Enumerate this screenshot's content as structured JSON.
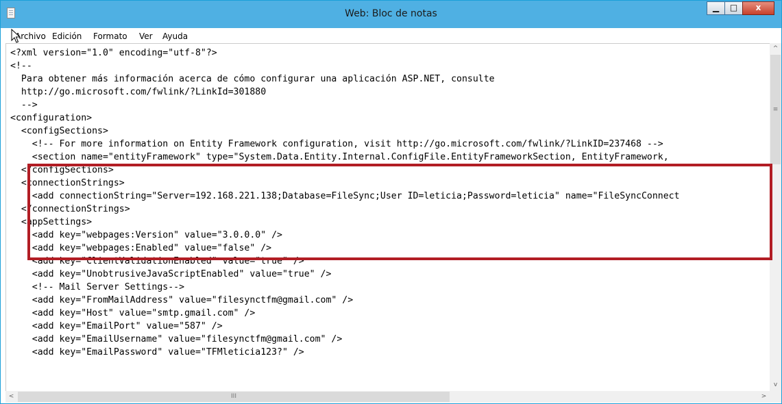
{
  "window": {
    "title": "Web: Bloc de notas",
    "controls": {
      "minimize": "▁",
      "maximize": "□",
      "close": "x"
    }
  },
  "menu": [
    "Archivo",
    "Edición",
    "Formato",
    "Ver",
    "Ayuda"
  ],
  "editor": {
    "lines": [
      "<?xml version=\"1.0\" encoding=\"utf-8\"?>",
      "<!--",
      "  Para obtener más información acerca de cómo configurar una aplicación ASP.NET, consulte",
      "  http://go.microsoft.com/fwlink/?LinkId=301880",
      "  -->",
      "<configuration>",
      "  <configSections>",
      "    <!-- For more information on Entity Framework configuration, visit http://go.microsoft.com/fwlink/?LinkID=237468 -->",
      "    <section name=\"entityFramework\" type=\"System.Data.Entity.Internal.ConfigFile.EntityFrameworkSection, EntityFramework, ",
      "  </configSections>",
      "  <connectionStrings>",
      "    <add connectionString=\"Server=192.168.221.138;Database=FileSync;User ID=leticia;Password=leticia\" name=\"FileSyncConnect",
      "  </connectionStrings>",
      "  <appSettings>",
      "    <add key=\"webpages:Version\" value=\"3.0.0.0\" />",
      "    <add key=\"webpages:Enabled\" value=\"false\" />",
      "    <add key=\"ClientValidationEnabled\" value=\"true\" />",
      "    <add key=\"UnobtrusiveJavaScriptEnabled\" value=\"true\" />",
      "    <!-- Mail Server Settings-->",
      "    <add key=\"FromMailAddress\" value=\"filesynctfm@gmail.com\" />",
      "    <add key=\"Host\" value=\"smtp.gmail.com\" />",
      "    <add key=\"EmailPort\" value=\"587\" />",
      "    <add key=\"EmailUsername\" value=\"filesynctfm@gmail.com\" />",
      "    <add key=\"EmailPassword\" value=\"TFMleticia123?\" />"
    ]
  },
  "scrollbars": {
    "up": "^",
    "down": "v",
    "left": "<",
    "right": ">",
    "v_grip": "≡",
    "h_grip": "III"
  },
  "colors": {
    "titlebar": "#4fb0e3",
    "highlight": "#b21d24",
    "close": "#c8412b"
  }
}
